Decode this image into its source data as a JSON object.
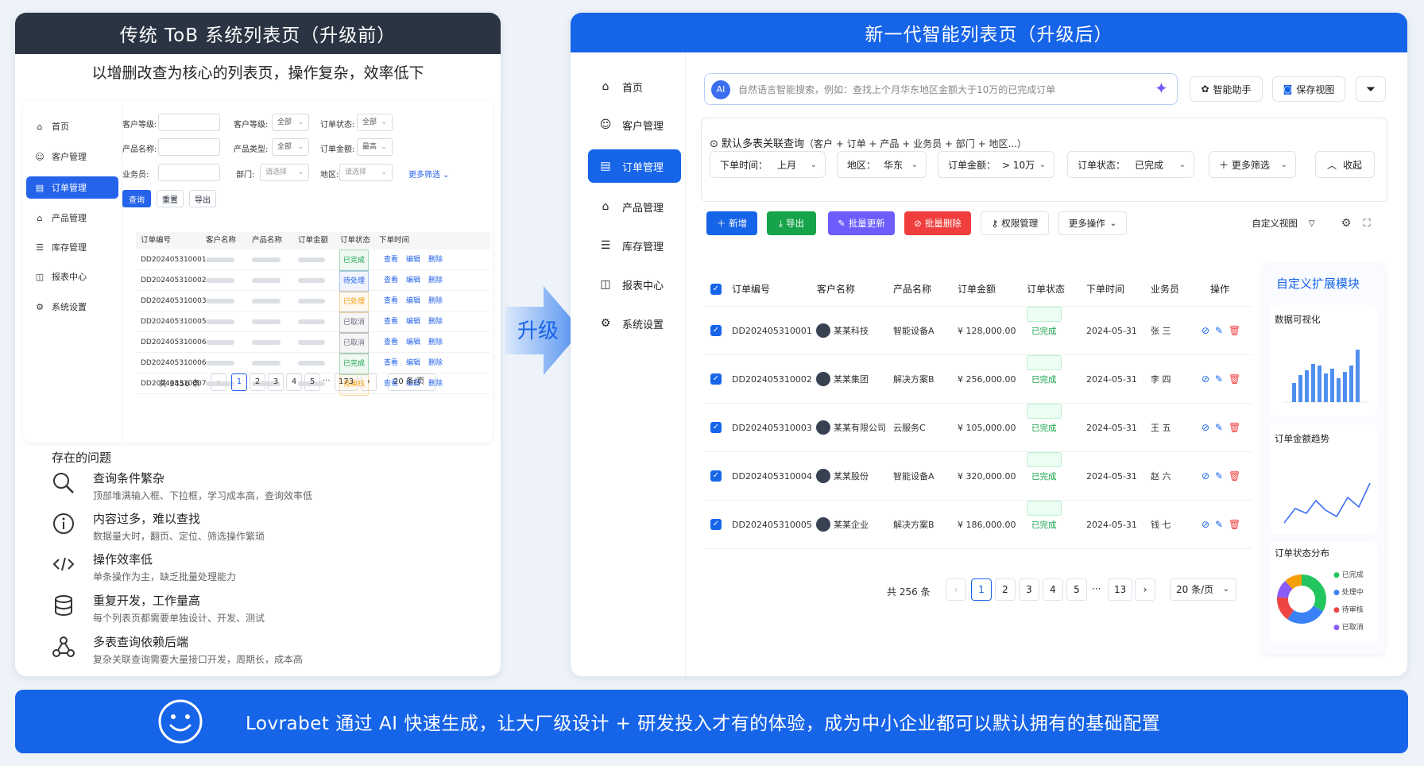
{
  "left": {
    "title": "传统 ToB 系统列表页（升级前）",
    "subtitle": "以增删改查为核心的列表页，操作复杂，效率低下",
    "nav": [
      {
        "label": "首页",
        "icon": "home-icon"
      },
      {
        "label": "客户管理",
        "icon": "user-icon"
      },
      {
        "label": "订单管理",
        "icon": "order-icon",
        "active": true
      },
      {
        "label": "产品管理",
        "icon": "product-icon"
      },
      {
        "label": "库存管理",
        "icon": "inventory-icon"
      },
      {
        "label": "报表中心",
        "icon": "report-icon"
      },
      {
        "label": "系统设置",
        "icon": "gear-icon"
      }
    ],
    "filters": {
      "customer_level_a": "客户等级:",
      "customer_level_b": "客户等级:",
      "customer_level_b_val": "全部",
      "order_status": "订单状态:",
      "order_status_val": "全部",
      "product_name": "产品名称:",
      "product_type": "产品类型:",
      "product_type_val": "全部",
      "order_amount": "订单金额:",
      "order_amount_val": "最高",
      "salesperson": "业务员:",
      "dept": "部门:",
      "dept_val": "请选择",
      "region": "地区:",
      "region_val": "请选择",
      "more": "更多筛选 ⌄"
    },
    "buttons": {
      "query": "查询",
      "reset": "重置",
      "export": "导出"
    },
    "table": {
      "headers": [
        "订单编号",
        "客户名称",
        "产品名称",
        "订单金额",
        "订单状态",
        "下单时间"
      ],
      "rows": [
        {
          "id": "DD202405310001",
          "status": "已完成",
          "color": "#16a34a"
        },
        {
          "id": "DD202405310002",
          "status": "待处理",
          "color": "#2563eb"
        },
        {
          "id": "DD202405310003",
          "status": "已处理",
          "color": "#f59e0b"
        },
        {
          "id": "DD202405310005",
          "status": "已取消",
          "color": "#6b7280"
        },
        {
          "id": "DD202405310006",
          "status": "已取消",
          "color": "#6b7280"
        },
        {
          "id": "DD202405310006",
          "status": "已完成",
          "color": "#16a34a"
        },
        {
          "id": "DD202405310007",
          "status": "待审核",
          "color": "#f59e0b"
        }
      ],
      "ops": [
        "查看",
        "编辑",
        "删除"
      ]
    },
    "pagination": {
      "total": "共 3456 条",
      "prev": "‹",
      "pages": [
        "1",
        "2",
        "3",
        "4",
        "5"
      ],
      "ellipsis": "···",
      "last": "173",
      "next": "›",
      "size": "20 条/页"
    },
    "issues_title": "存在的问题",
    "issues": [
      {
        "title": "查询条件繁杂",
        "desc": "顶部堆满输入框、下拉框，学习成本高，查询效率低",
        "icon": "search-icon"
      },
      {
        "title": "内容过多，难以查找",
        "desc": "数据量大时，翻页、定位、筛选操作繁琐",
        "icon": "info-icon"
      },
      {
        "title": "操作效率低",
        "desc": "单条操作为主，缺乏批量处理能力",
        "icon": "code-icon"
      },
      {
        "title": "重复开发，工作量高",
        "desc": "每个列表页都需要单独设计、开发、测试",
        "icon": "database-icon"
      },
      {
        "title": "多表查询依赖后端",
        "desc": "复杂关联查询需要大量接口开发，周期长，成本高",
        "icon": "network-icon"
      }
    ]
  },
  "arrow_label": "升级",
  "right": {
    "title": "新一代智能列表页（升级后）",
    "nav": [
      {
        "label": "首页",
        "icon": "home-icon"
      },
      {
        "label": "客户管理",
        "icon": "user-icon"
      },
      {
        "label": "订单管理",
        "icon": "order-icon",
        "active": true
      },
      {
        "label": "产品管理",
        "icon": "product-icon"
      },
      {
        "label": "库存管理",
        "icon": "inventory-icon"
      },
      {
        "label": "报表中心",
        "icon": "report-icon"
      },
      {
        "label": "系统设置",
        "icon": "gear-icon"
      }
    ],
    "ai_badge": "AI",
    "search_placeholder": "自然语言智能搜索，例如：查找上个月华东地区金额大于10万的已完成订单",
    "assistant": "智能助手",
    "save_view": "保存视图",
    "query_title": "默认多表关联查询",
    "query_hint": "（客户 + 订单 + 产品 + 业务员 + 部门 + 地区...）",
    "filters": [
      {
        "label": "下单时间：",
        "value": "上月"
      },
      {
        "label": "地区：",
        "value": "华东"
      },
      {
        "label": "订单金额：",
        "value": "> 10万"
      },
      {
        "label": "订单状态：",
        "value": "已完成"
      }
    ],
    "more_filters": "＋ 更多筛选",
    "collapse": "收起",
    "actions": {
      "add": "＋ 新增",
      "export": "导出",
      "batch_update": "批量更新",
      "batch_delete": "批量删除",
      "perm": "权限管理",
      "more": "更多操作"
    },
    "custom_view": "自定义视图",
    "table": {
      "headers": [
        "订单编号",
        "客户名称",
        "产品名称",
        "订单金额",
        "订单状态",
        "下单时间",
        "业务员",
        "操作"
      ],
      "rows": [
        {
          "id": "DD202405310001",
          "customer": "某某科技",
          "product": "智能设备A",
          "amount": "¥ 128,000.00",
          "status": "已完成",
          "date": "2024-05-31",
          "sales": "张 三"
        },
        {
          "id": "DD202405310002",
          "customer": "某某集团",
          "product": "解决方案B",
          "amount": "¥ 256,000.00",
          "status": "已完成",
          "date": "2024-05-31",
          "sales": "李 四"
        },
        {
          "id": "DD202405310003",
          "customer": "某某有限公司",
          "product": "云服务C",
          "amount": "¥ 105,000.00",
          "status": "已完成",
          "date": "2024-05-31",
          "sales": "王 五"
        },
        {
          "id": "DD202405310004",
          "customer": "某某股份",
          "product": "智能设备A",
          "amount": "¥ 320,000.00",
          "status": "已完成",
          "date": "2024-05-31",
          "sales": "赵 六"
        },
        {
          "id": "DD202405310005",
          "customer": "某某企业",
          "product": "解决方案B",
          "amount": "¥ 186,000.00",
          "status": "已完成",
          "date": "2024-05-31",
          "sales": "钱 七"
        }
      ]
    },
    "pagination": {
      "total": "共 256 条",
      "prev": "‹",
      "pages": [
        "1",
        "2",
        "3",
        "4",
        "5"
      ],
      "ellipsis": "···",
      "last": "13",
      "next": "›",
      "size": "20 条/页"
    },
    "ext": {
      "title": "自定义扩展模块",
      "viz": "数据可视化",
      "trend": "订单金额趋势",
      "dist": "订单状态分布",
      "legend": [
        {
          "label": "已完成",
          "color": "#22c55e"
        },
        {
          "label": "处理中",
          "color": "#3b82f6"
        },
        {
          "label": "待审核",
          "color": "#ef4444"
        },
        {
          "label": "已取消",
          "color": "#8b5cf6"
        }
      ]
    }
  },
  "footer": "Lovrabet  通过 AI 快速生成，让大厂级设计 + 研发投入才有的体验，成为中小企业都可以默认拥有的基础配置",
  "colors": {
    "primary": "#1664e8",
    "dark_header": "#2a3442",
    "success": "#16a34a",
    "danger": "#ef4444",
    "teal": "#16a34a"
  }
}
